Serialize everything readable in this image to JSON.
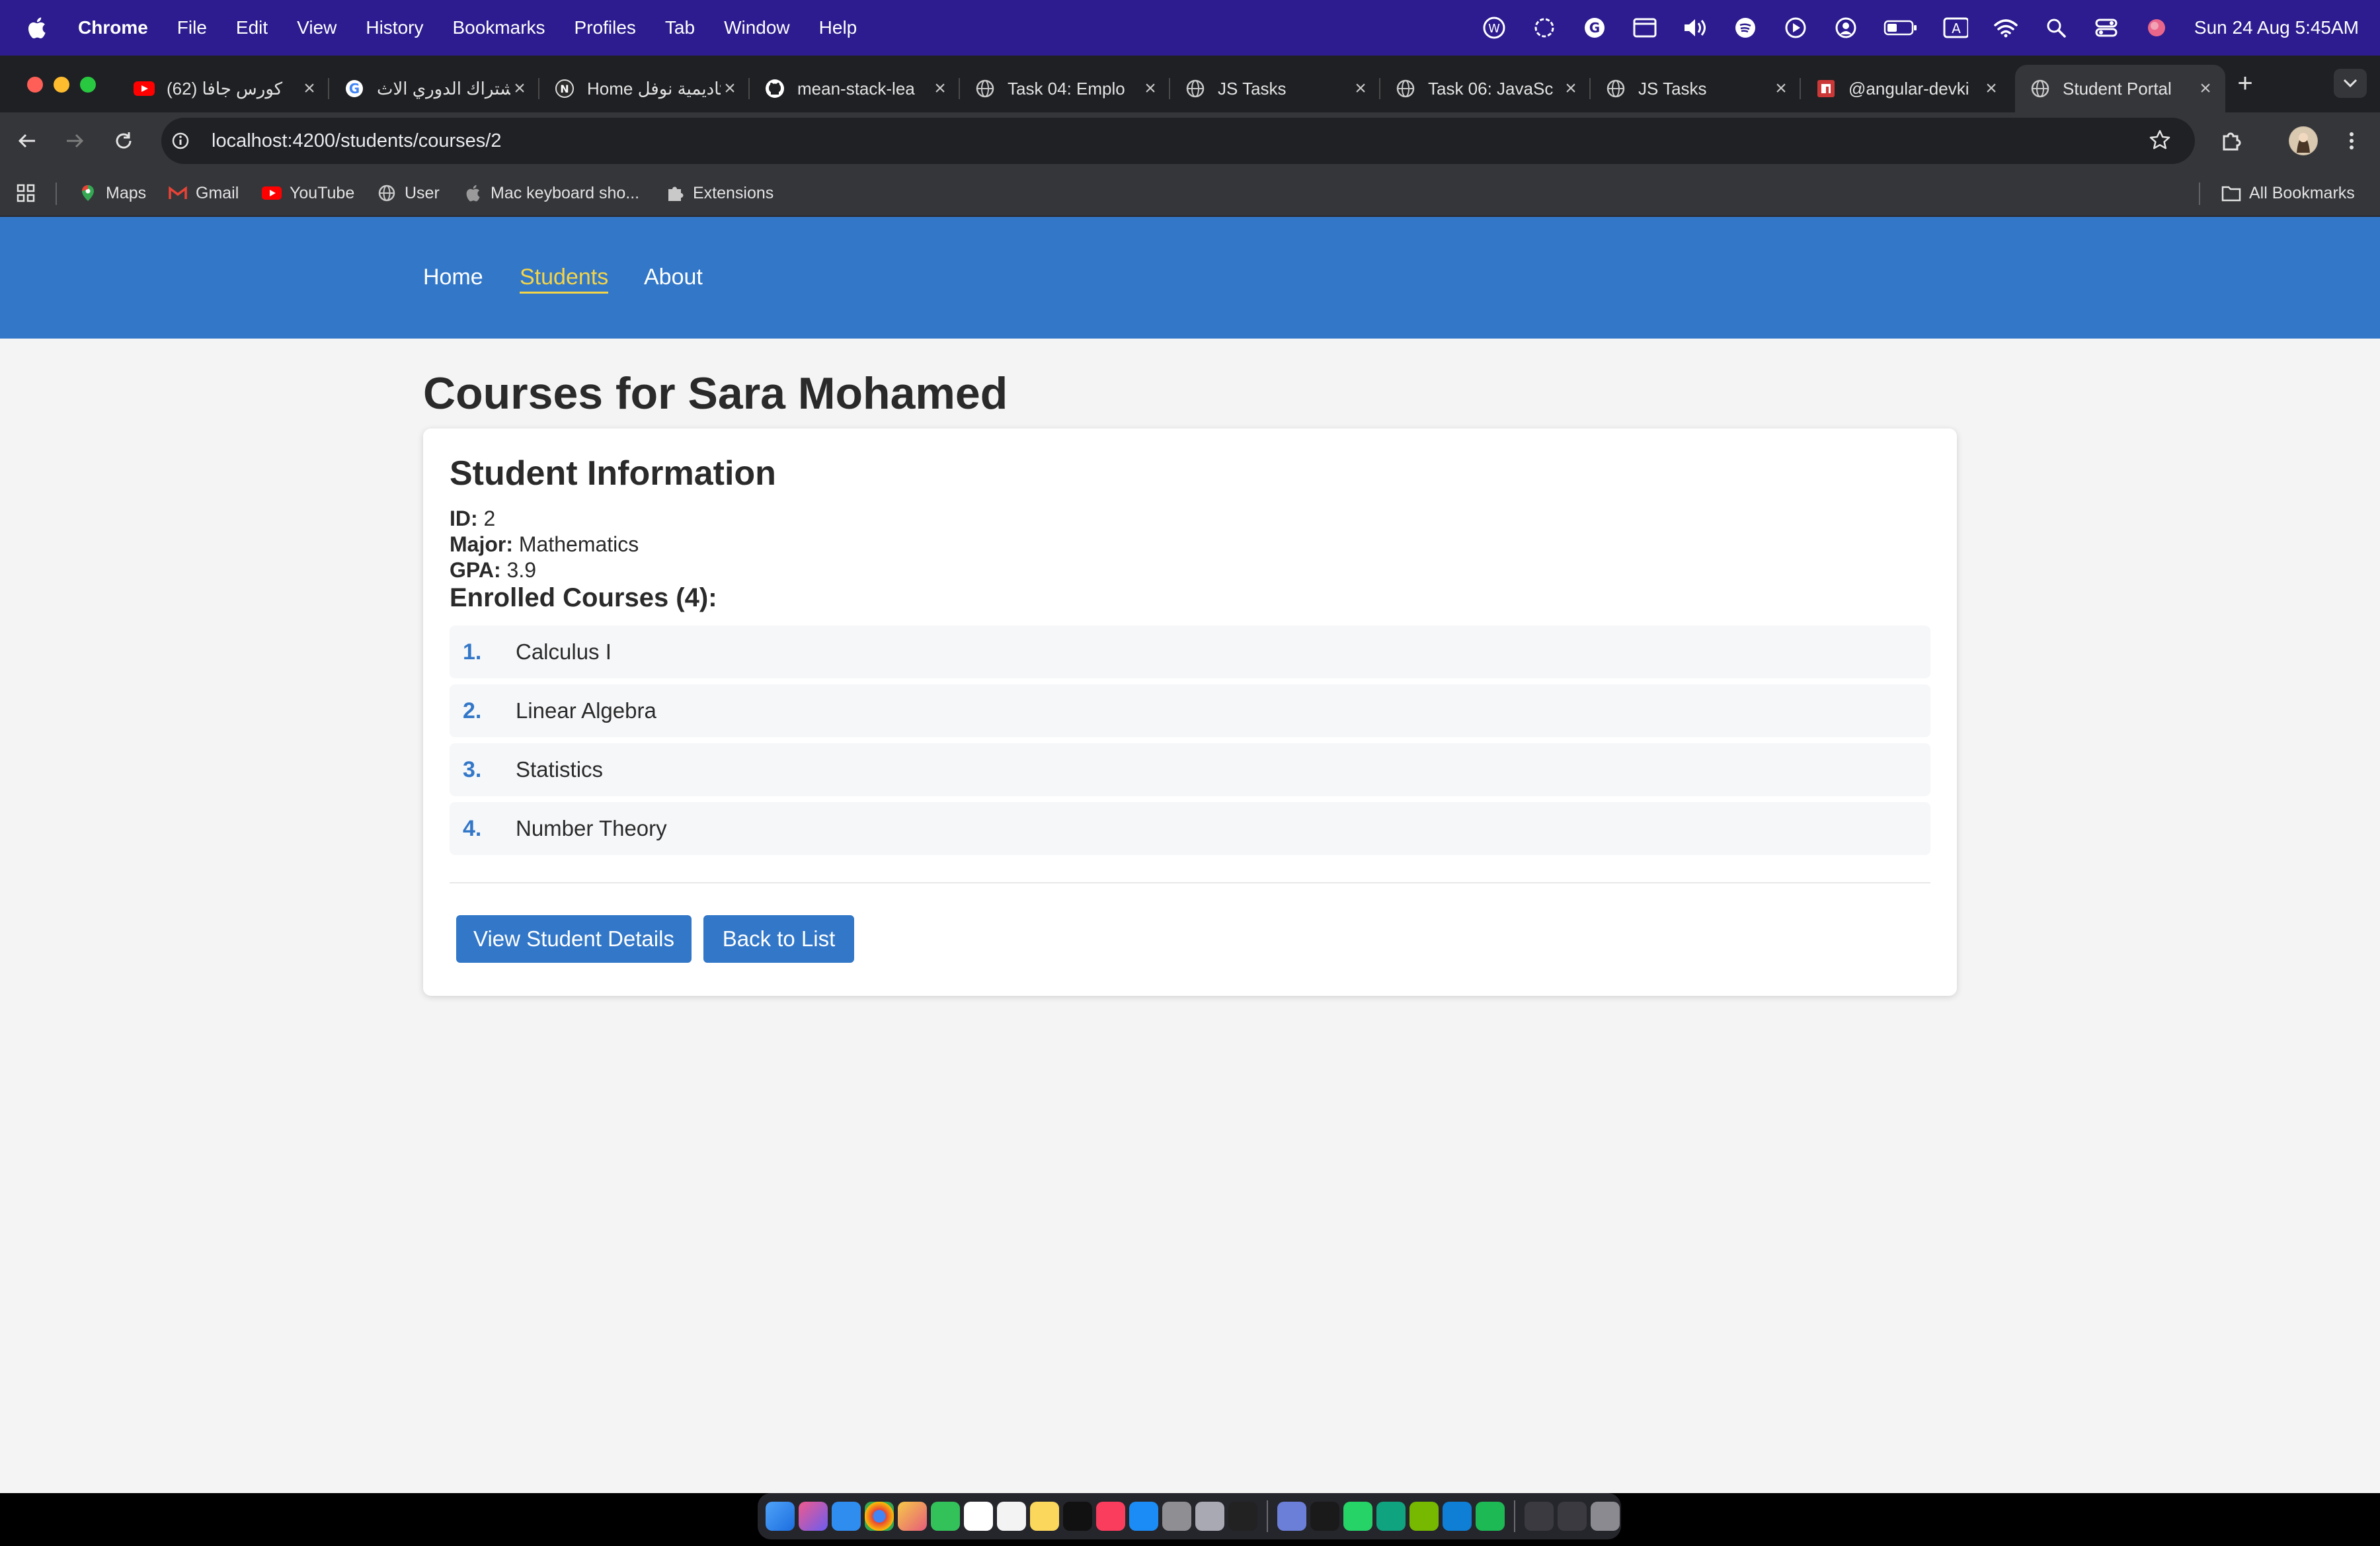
{
  "menubar": {
    "app_name": "Chrome",
    "items": [
      "File",
      "Edit",
      "View",
      "History",
      "Bookmarks",
      "Profiles",
      "Tab",
      "Window",
      "Help"
    ],
    "clock": "Sun 24 Aug  5:45AM"
  },
  "tabs": [
    {
      "title": "(62) كورس جافا",
      "icon": "youtube-icon"
    },
    {
      "title": "اشتراك الدوري الاث",
      "icon": "google-icon"
    },
    {
      "title": "Home أكاديمية نوفل",
      "icon": "notion-icon"
    },
    {
      "title": "mean-stack-lea",
      "icon": "github-icon"
    },
    {
      "title": "Task 04: Emplo",
      "icon": "globe-icon"
    },
    {
      "title": "JS Tasks",
      "icon": "globe-icon"
    },
    {
      "title": "Task 06: JavaSc",
      "icon": "globe-icon"
    },
    {
      "title": "JS Tasks",
      "icon": "globe-icon"
    },
    {
      "title": "@angular-devki",
      "icon": "npm-icon"
    },
    {
      "title": "Student Portal",
      "icon": "globe-icon",
      "active": true
    }
  ],
  "address_bar": {
    "url": "localhost:4200/students/courses/2"
  },
  "bookmarks": [
    {
      "label": "Maps",
      "icon": "maps-icon"
    },
    {
      "label": "Gmail",
      "icon": "gmail-icon"
    },
    {
      "label": "YouTube",
      "icon": "youtube-icon"
    },
    {
      "label": "User",
      "icon": "globe-icon"
    },
    {
      "label": "Mac keyboard sho...",
      "icon": "apple-icon"
    },
    {
      "label": "Extensions",
      "icon": "puzzle-icon"
    }
  ],
  "all_bookmarks_label": "All Bookmarks",
  "nav": {
    "home": "Home",
    "students": "Students",
    "about": "About"
  },
  "page": {
    "heading": "Courses for Sara Mohamed",
    "card_title": "Student Information",
    "id_label": "ID:",
    "id_value": "2",
    "major_label": "Major:",
    "major_value": "Mathematics",
    "gpa_label": "GPA:",
    "gpa_value": "3.9",
    "enrolled_label": "Enrolled Courses (4):",
    "courses": [
      {
        "num": "1.",
        "name": "Calculus I"
      },
      {
        "num": "2.",
        "name": "Linear Algebra"
      },
      {
        "num": "3.",
        "name": "Statistics"
      },
      {
        "num": "4.",
        "name": "Number Theory"
      }
    ],
    "view_details_label": "View Student Details",
    "back_label": "Back to List"
  },
  "colors": {
    "menubar_bg": "#2c1c8f",
    "navbar_bg": "#3277c8",
    "nav_active": "#f5d547",
    "button_bg": "#3277c8",
    "course_number": "#3277c8"
  }
}
